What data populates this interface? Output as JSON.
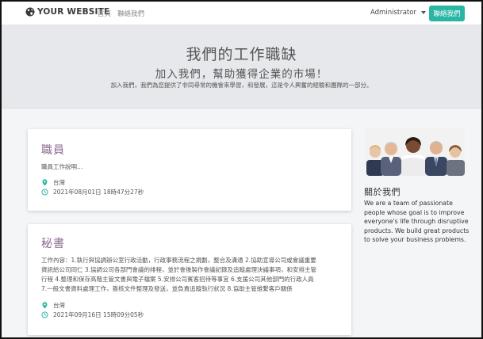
{
  "nav": {
    "brand": "YOUR WEBSITE",
    "home": "首頁",
    "contact": "聯絡我們",
    "user": "Administrator",
    "cta": "聯絡我們"
  },
  "hero": {
    "title": "我們的工作職缺",
    "subtitle": "加入我們，幫助獲得企業的市場！",
    "description": "加入我們，我們為您提供了非同尋常的機會來學習，和發展，這是令人興奮的經驗和團隊的一部分。"
  },
  "jobs": [
    {
      "title": "職員",
      "description": "職員工作說明...",
      "location": "台灣",
      "datetime": "2021年08月01日 18時47分27秒"
    },
    {
      "title": "秘書",
      "description": "工作內容：1.執行與協調辦公室行政活動，行政事務流程之規劃，整合及溝通 2.協助宣導公司或會議重要資訊給公司同仁 3.協調公司各部門會議的排程，並於會後製作會議記錄及追蹤處理決議事項，和安排主管行程 4.整理和保存高階主管文書與電子檔案 5.安排公司賓客招待等事宜 6.支援公司其他部門的行政人員 7.一般文書資料處理工作，簽核文件整理及發送，並負責追蹤執行狀況 8.協助主管維繫客戶關係",
      "location": "台灣",
      "datetime": "2021年09月16日 15時09分05秒"
    }
  ],
  "about": {
    "title": "關於我們",
    "text": "We are a team of passionate people whose goal is to improve everyone's life through disruptive products. We build great products to solve your business problems."
  },
  "colors": {
    "accent": "#2bb5a5",
    "job_title": "#8a6a8e",
    "hero_bg": "#e6e8eb"
  }
}
